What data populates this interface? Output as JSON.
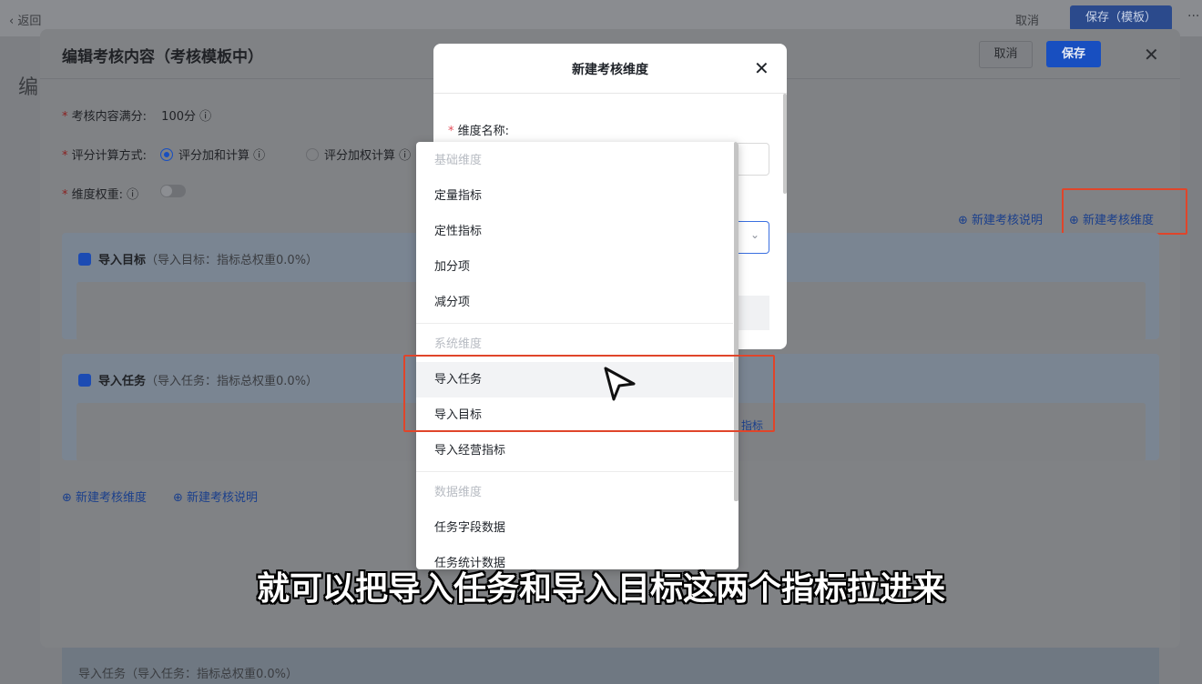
{
  "topbar": {
    "back_label": "返回",
    "cancel_label": "取消",
    "save_label": "保存（模板）",
    "more_label": "···"
  },
  "background": {
    "edit_title_fragment": "编",
    "bottom_card_text": "导入任务（导入任务：指标总权重0.0%）"
  },
  "panel": {
    "title": "编辑考核内容（考核模板中）",
    "cancel_label": "取消",
    "save_label": "保存",
    "full_score_label": "考核内容满分:",
    "full_score_value": "100分 ⓘ",
    "calc_method_label": "评分计算方式:",
    "calc_option_sum": "评分加和计算 ⓘ",
    "calc_option_weighted": "评分加权计算 ⓘ",
    "weight_label": "维度权重: ⓘ",
    "weight_enabled": false,
    "link_new_description": "新建考核说明",
    "link_new_dimension": "新建考核维度",
    "cards": [
      {
        "title": "导入目标",
        "subtitle": "（导入目标：指标总权重0.0%）"
      },
      {
        "title": "导入任务",
        "subtitle": "（导入任务：指标总权重0.0%）"
      }
    ],
    "bottom_link_new_dimension": "新建考核维度",
    "bottom_link_new_description": "新建考核说明",
    "peek_link": "指标"
  },
  "dialog": {
    "title": "新建考核维度",
    "name_label": "维度名称:",
    "name_required_mark": "*"
  },
  "dropdown": {
    "groups": [
      {
        "label": "基础维度",
        "items": [
          "定量指标",
          "定性指标",
          "加分项",
          "减分项"
        ]
      },
      {
        "label": "系统维度",
        "items": [
          "导入任务",
          "导入目标",
          "导入经营指标"
        ]
      },
      {
        "label": "数据维度",
        "items": [
          "任务字段数据",
          "任务统计数据"
        ]
      }
    ],
    "hovered_item": "导入任务"
  },
  "subtitle": "就可以把导入任务和导入目标这两个指标拉进来",
  "colors": {
    "accent": "#184fc0",
    "highlight": "#e0452a"
  }
}
